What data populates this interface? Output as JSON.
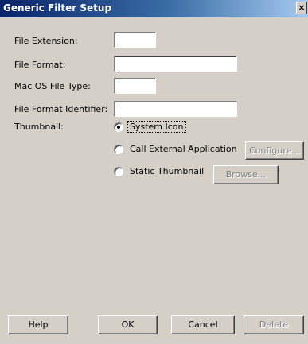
{
  "window": {
    "title": "Generic Filter Setup",
    "close_glyph": "×"
  },
  "form": {
    "file_extension": {
      "label": "File Extension:",
      "value": ""
    },
    "file_format": {
      "label": "File Format:",
      "value": ""
    },
    "mac_os_file_type": {
      "label": "Mac OS File Type:",
      "value": ""
    },
    "file_format_identifier": {
      "label": "File Format Identifier:",
      "value": ""
    },
    "thumbnail_label": "Thumbnail:"
  },
  "thumbnail_options": [
    {
      "label": "System Icon",
      "selected": true
    },
    {
      "label": "Call External Application",
      "selected": false
    },
    {
      "label": "Static Thumbnail",
      "selected": false
    }
  ],
  "buttons": {
    "configure": "Configure...",
    "browse": "Browse...",
    "help": "Help",
    "ok": "OK",
    "cancel": "Cancel",
    "delete": "Delete"
  }
}
